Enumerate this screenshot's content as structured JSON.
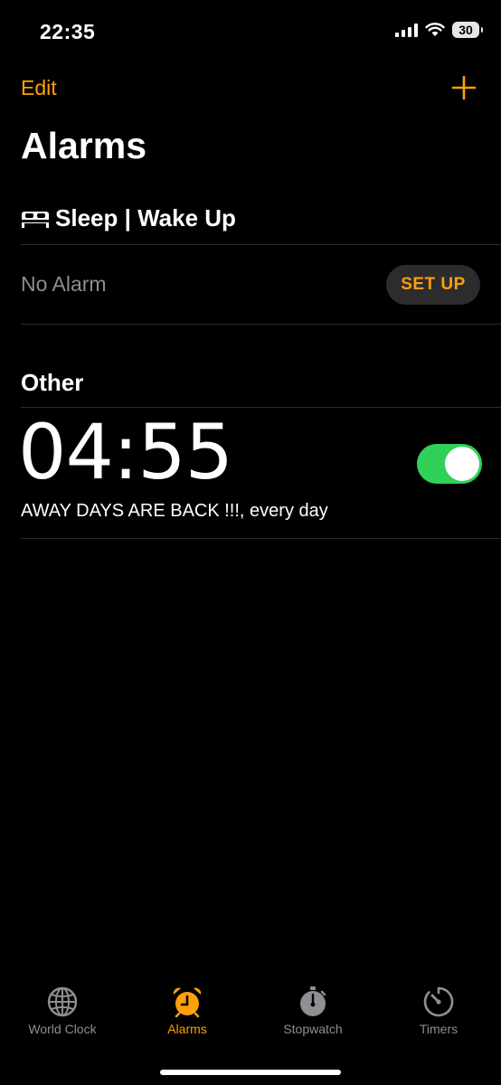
{
  "status_bar": {
    "time": "22:35",
    "battery_level": "30",
    "icons": [
      "cellular-signal-icon",
      "wifi-icon",
      "battery-icon"
    ]
  },
  "nav": {
    "edit_label": "Edit",
    "add_icon": "plus-icon"
  },
  "page_title": "Alarms",
  "sleep_section": {
    "icon": "bed-icon",
    "title": "Sleep | Wake Up",
    "status_text": "No Alarm",
    "setup_label": "SET UP"
  },
  "other_section": {
    "title": "Other",
    "alarms": [
      {
        "time": "04:55",
        "label": "AWAY DAYS ARE BACK !!!, every day",
        "enabled": true
      }
    ]
  },
  "tab_bar": {
    "tabs": [
      {
        "label": "World Clock",
        "icon": "globe-icon",
        "active": false
      },
      {
        "label": "Alarms",
        "icon": "alarm-clock-icon",
        "active": true
      },
      {
        "label": "Stopwatch",
        "icon": "stopwatch-icon",
        "active": false
      },
      {
        "label": "Timers",
        "icon": "timer-icon",
        "active": false
      }
    ]
  },
  "colors": {
    "accent": "#ff9f0a",
    "toggle_on": "#30d158",
    "background": "#000000",
    "secondary_text": "#8e8e93",
    "divider": "#2c2c2e"
  }
}
